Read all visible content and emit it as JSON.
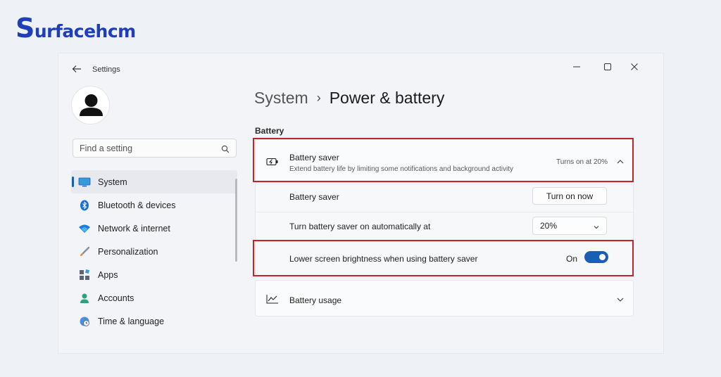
{
  "brand": {
    "first_letter": "S",
    "rest": "urfacehcm"
  },
  "window": {
    "title": "Settings"
  },
  "icons": {
    "back": "back-arrow-icon",
    "minimize": "minimize-icon",
    "maximize": "maximize-icon",
    "close": "close-icon",
    "search": "search-icon",
    "avatar": "user-avatar-icon",
    "battery_saver": "battery-saver-icon",
    "battery_usage": "line-chart-icon"
  },
  "search": {
    "placeholder": "Find a setting"
  },
  "sidebar": {
    "items": [
      {
        "label": "System",
        "icon": "display-icon",
        "active": true
      },
      {
        "label": "Bluetooth & devices",
        "icon": "bluetooth-icon"
      },
      {
        "label": "Network & internet",
        "icon": "wifi-icon"
      },
      {
        "label": "Personalization",
        "icon": "brush-icon"
      },
      {
        "label": "Apps",
        "icon": "apps-icon"
      },
      {
        "label": "Accounts",
        "icon": "person-icon"
      },
      {
        "label": "Time & language",
        "icon": "clock-globe-icon"
      }
    ]
  },
  "breadcrumb": {
    "parent": "System",
    "separator": "›",
    "current": "Power & battery"
  },
  "section": {
    "label": "Battery"
  },
  "battery_saver": {
    "title": "Battery saver",
    "description": "Extend battery life by limiting some notifications and background activity",
    "status": "Turns on at 20%",
    "expanded": true
  },
  "rows": {
    "saver_now": {
      "label": "Battery saver",
      "button": "Turn on now"
    },
    "auto": {
      "label": "Turn battery saver on automatically at",
      "value": "20%"
    },
    "brightness": {
      "label": "Lower screen brightness when using battery saver",
      "state_label": "On",
      "on": true
    }
  },
  "battery_usage": {
    "label": "Battery usage"
  },
  "colors": {
    "accent": "#1a5fb4",
    "highlight": "#c0252b",
    "brand": "#1f3fb8"
  }
}
